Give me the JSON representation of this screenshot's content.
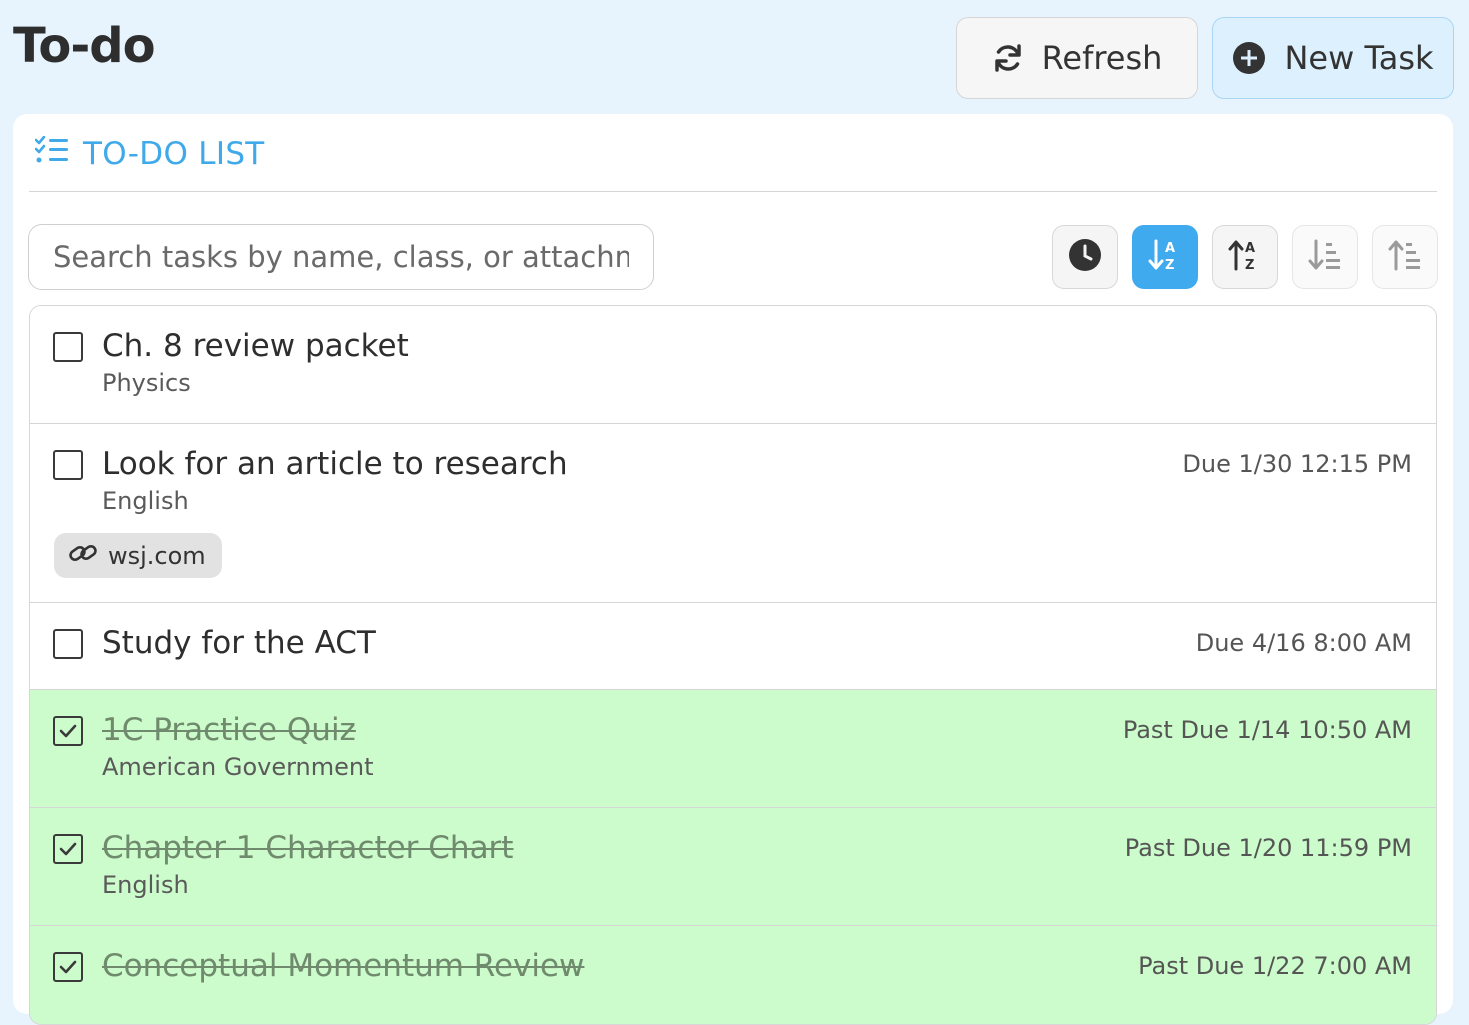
{
  "header": {
    "title": "To-do",
    "refresh_label": "Refresh",
    "new_task_label": "New Task"
  },
  "card": {
    "title": "TO-DO LIST",
    "search": {
      "placeholder": "Search tasks by name, class, or attachment",
      "value": ""
    },
    "sort_buttons": [
      {
        "icon": "clock-icon",
        "active": false
      },
      {
        "icon": "sort-alpha-down-icon",
        "active": true
      },
      {
        "icon": "sort-alpha-up-icon",
        "active": false
      },
      {
        "icon": "sort-amount-down-icon",
        "active": false
      },
      {
        "icon": "sort-amount-up-icon",
        "active": false
      }
    ]
  },
  "tasks": [
    {
      "name": "Ch. 8 review packet",
      "class": "Physics",
      "due": "",
      "done": false
    },
    {
      "name": "Look for an article to research",
      "class": "English",
      "due": "Due 1/30 12:15 PM",
      "done": false,
      "attachment": "wsj.com"
    },
    {
      "name": "Study for the ACT",
      "class": "",
      "due": "Due 4/16 8:00 AM",
      "done": false
    },
    {
      "name": "1C Practice Quiz",
      "class": "American Government",
      "due": "Past Due 1/14 10:50 AM",
      "done": true
    },
    {
      "name": "Chapter 1 Character Chart",
      "class": "English",
      "due": "Past Due 1/20 11:59 PM",
      "done": true
    },
    {
      "name": "Conceptual Momentum Review",
      "class": "",
      "due": "Past Due 1/22 7:00 AM",
      "done": true
    }
  ],
  "colors": {
    "background": "#e8f4fd",
    "accent": "#3faaee",
    "done_row": "#ccfccb"
  }
}
